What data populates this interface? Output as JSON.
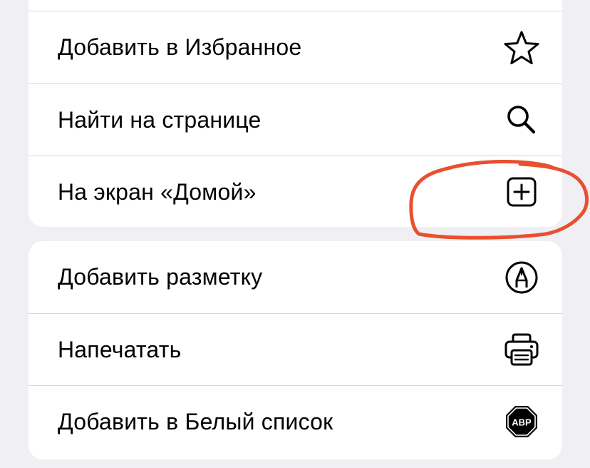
{
  "menu": {
    "group1": [
      {
        "label": "Добавить в Избранное",
        "icon": "star-icon"
      },
      {
        "label": "Найти на странице",
        "icon": "search-icon"
      },
      {
        "label": "На экран «Домой»",
        "icon": "add-square-icon"
      }
    ],
    "group2": [
      {
        "label": "Добавить разметку",
        "icon": "markup-pen-icon"
      },
      {
        "label": "Напечатать",
        "icon": "printer-icon"
      },
      {
        "label": "Добавить в Белый список",
        "icon": "abp-icon"
      }
    ]
  },
  "icons": {
    "abp_text": "ABP"
  },
  "annotation": {
    "color": "#e8502f",
    "target": "На экран «Домой»"
  }
}
